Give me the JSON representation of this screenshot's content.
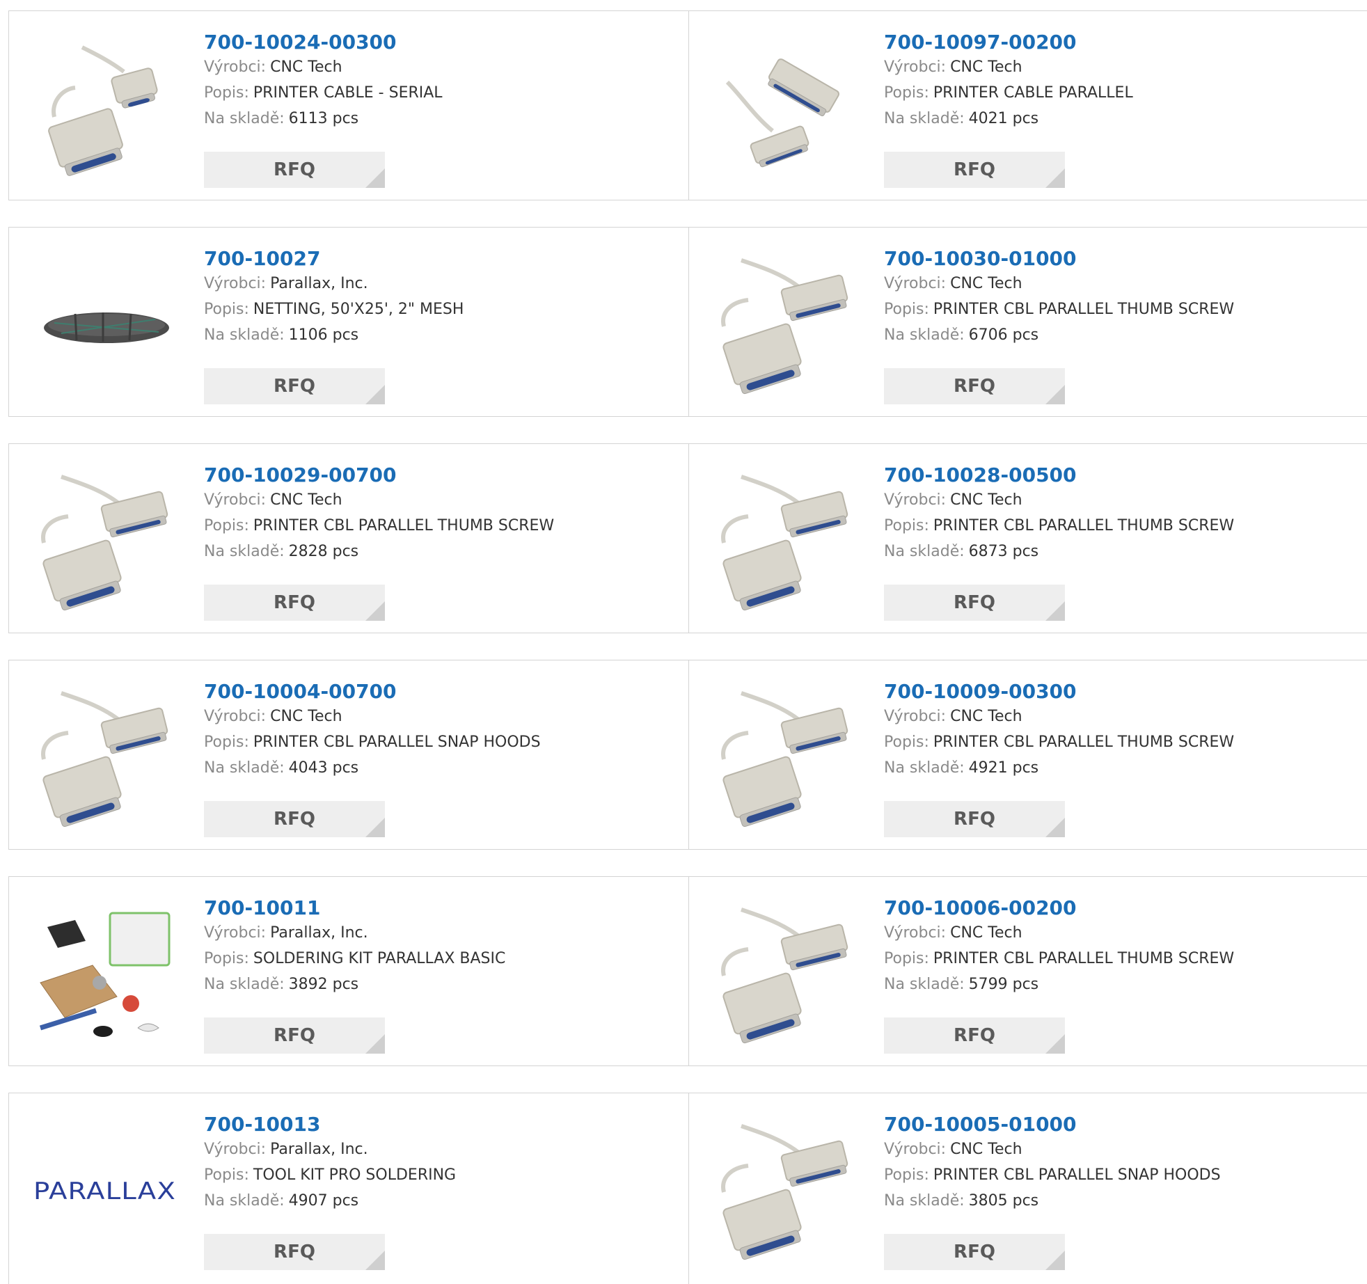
{
  "labels": {
    "maker": "Výrobci:",
    "desc": "Popis:",
    "stock": "Na skladě:",
    "rfq": "RFQ"
  },
  "colors": {
    "link": "#1a6cb5",
    "border": "#d4d4d4",
    "button_bg": "#eeeeee",
    "button_corner": "#cfcfcf",
    "label": "#8a8a8a"
  },
  "products": [
    {
      "part": "700-10024-00300",
      "maker": "CNC Tech",
      "desc": "PRINTER CABLE - SERIAL",
      "stock": "6113 pcs",
      "image": "serial-cable"
    },
    {
      "part": "700-10097-00200",
      "maker": "CNC Tech",
      "desc": "PRINTER CABLE PARALLEL",
      "stock": "4021 pcs",
      "image": "parallel-cable-diagonal"
    },
    {
      "part": "700-10027",
      "maker": "Parallax, Inc.",
      "desc": "NETTING, 50'X25', 2\" MESH",
      "stock": "1106 pcs",
      "image": "netting"
    },
    {
      "part": "700-10030-01000",
      "maker": "CNC Tech",
      "desc": "PRINTER CBL PARALLEL THUMB SCREW",
      "stock": "6706 pcs",
      "image": "parallel-cable"
    },
    {
      "part": "700-10029-00700",
      "maker": "CNC Tech",
      "desc": "PRINTER CBL PARALLEL THUMB SCREW",
      "stock": "2828 pcs",
      "image": "parallel-cable"
    },
    {
      "part": "700-10028-00500",
      "maker": "CNC Tech",
      "desc": "PRINTER CBL PARALLEL THUMB SCREW",
      "stock": "6873 pcs",
      "image": "parallel-cable"
    },
    {
      "part": "700-10004-00700",
      "maker": "CNC Tech",
      "desc": "PRINTER CBL PARALLEL SNAP HOODS",
      "stock": "4043 pcs",
      "image": "parallel-cable"
    },
    {
      "part": "700-10009-00300",
      "maker": "CNC Tech",
      "desc": "PRINTER CBL PARALLEL THUMB SCREW",
      "stock": "4921 pcs",
      "image": "parallel-cable"
    },
    {
      "part": "700-10011",
      "maker": "Parallax, Inc.",
      "desc": "SOLDERING KIT PARALLAX BASIC",
      "stock": "3892 pcs",
      "image": "soldering-kit"
    },
    {
      "part": "700-10006-00200",
      "maker": "CNC Tech",
      "desc": "PRINTER CBL PARALLEL THUMB SCREW",
      "stock": "5799 pcs",
      "image": "parallel-cable"
    },
    {
      "part": "700-10013",
      "maker": "Parallax, Inc.",
      "desc": "TOOL KIT PRO SOLDERING",
      "stock": "4907 pcs",
      "image": "parallax-logo",
      "logo_text": "PARALLAX"
    },
    {
      "part": "700-10005-01000",
      "maker": "CNC Tech",
      "desc": "PRINTER CBL PARALLEL SNAP HOODS",
      "stock": "3805 pcs",
      "image": "parallel-cable"
    }
  ]
}
